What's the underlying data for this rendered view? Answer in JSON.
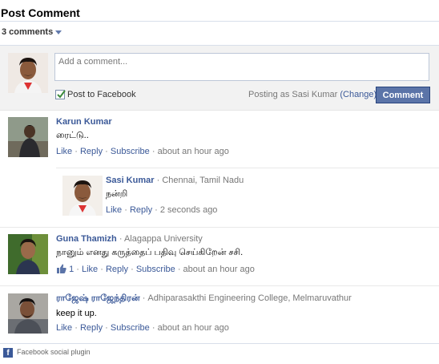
{
  "header": {
    "title": "Post Comment",
    "count_label": "3 comments"
  },
  "composer": {
    "placeholder": "Add a comment...",
    "post_to_facebook": "Post to Facebook",
    "posting_as": "Posting as Sasi Kumar",
    "change_label": "(Change)",
    "submit_label": "Comment"
  },
  "comments": [
    {
      "name": "Karun Kumar",
      "affiliation": "",
      "text": "ரைட்டு..",
      "like": "Like",
      "reply": "Reply",
      "subscribe": "Subscribe",
      "time": "about an hour ago"
    },
    {
      "name": "Guna Thamizh",
      "affiliation": "Alagappa University",
      "text": "நானும் எனது கருத்தைப் பதிவு செய்கிறேன் சசி.",
      "likes_count": "1",
      "like": "Like",
      "reply": "Reply",
      "subscribe": "Subscribe",
      "time": "about an hour ago"
    },
    {
      "name": "ராஜேஷ் ராஜேந்திரன்",
      "affiliation": "Adhiparasakthi Engineering College, Melmaruvathur",
      "text": "keep it up.",
      "like": "Like",
      "reply": "Reply",
      "subscribe": "Subscribe",
      "time": "about an hour ago"
    }
  ],
  "reply": {
    "name": "Sasi Kumar",
    "affiliation": "Chennai, Tamil Nadu",
    "text": "நன்றி",
    "like": "Like",
    "reply": "Reply",
    "time": "2 seconds ago"
  },
  "footer": {
    "label": "Facebook social plugin"
  },
  "colors": {
    "link": "#3b5998",
    "button": "#5b74a8",
    "composer_bg": "#f2f2f2"
  }
}
